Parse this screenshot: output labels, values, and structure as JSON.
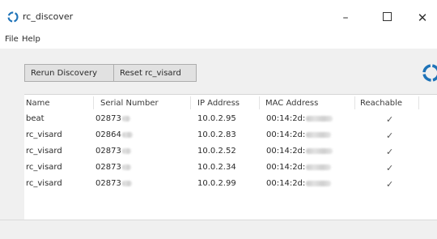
{
  "window": {
    "title": "rc_discover",
    "minimize_label": "–",
    "close_label": "✕"
  },
  "menu": {
    "file": "File",
    "help": "Help"
  },
  "toolbar": {
    "rerun_label": "Rerun Discovery",
    "reset_label": "Reset rc_visard"
  },
  "table": {
    "columns": [
      "Name",
      "Serial Number",
      "IP Address",
      "MAC Address",
      "Reachable"
    ],
    "rows": [
      {
        "name": "beat",
        "serial": "02873",
        "ip": "10.0.2.95",
        "mac": "00:14:2d:",
        "reachable": "✓"
      },
      {
        "name": "rc_visard",
        "serial": "02864",
        "ip": "10.0.2.83",
        "mac": "00:14:2d:",
        "reachable": "✓"
      },
      {
        "name": "rc_visard",
        "serial": "02873",
        "ip": "10.0.2.52",
        "mac": "00:14:2d:",
        "reachable": "✓"
      },
      {
        "name": "rc_visard",
        "serial": "02873",
        "ip": "10.0.2.34",
        "mac": "00:14:2d:",
        "reachable": "✓"
      },
      {
        "name": "rc_visard",
        "serial": "02873",
        "ip": "10.0.2.99",
        "mac": "00:14:2d:",
        "reachable": "✓"
      }
    ]
  },
  "colors": {
    "accent": "#1e73b8",
    "window_bg": "#f0f0f0"
  }
}
